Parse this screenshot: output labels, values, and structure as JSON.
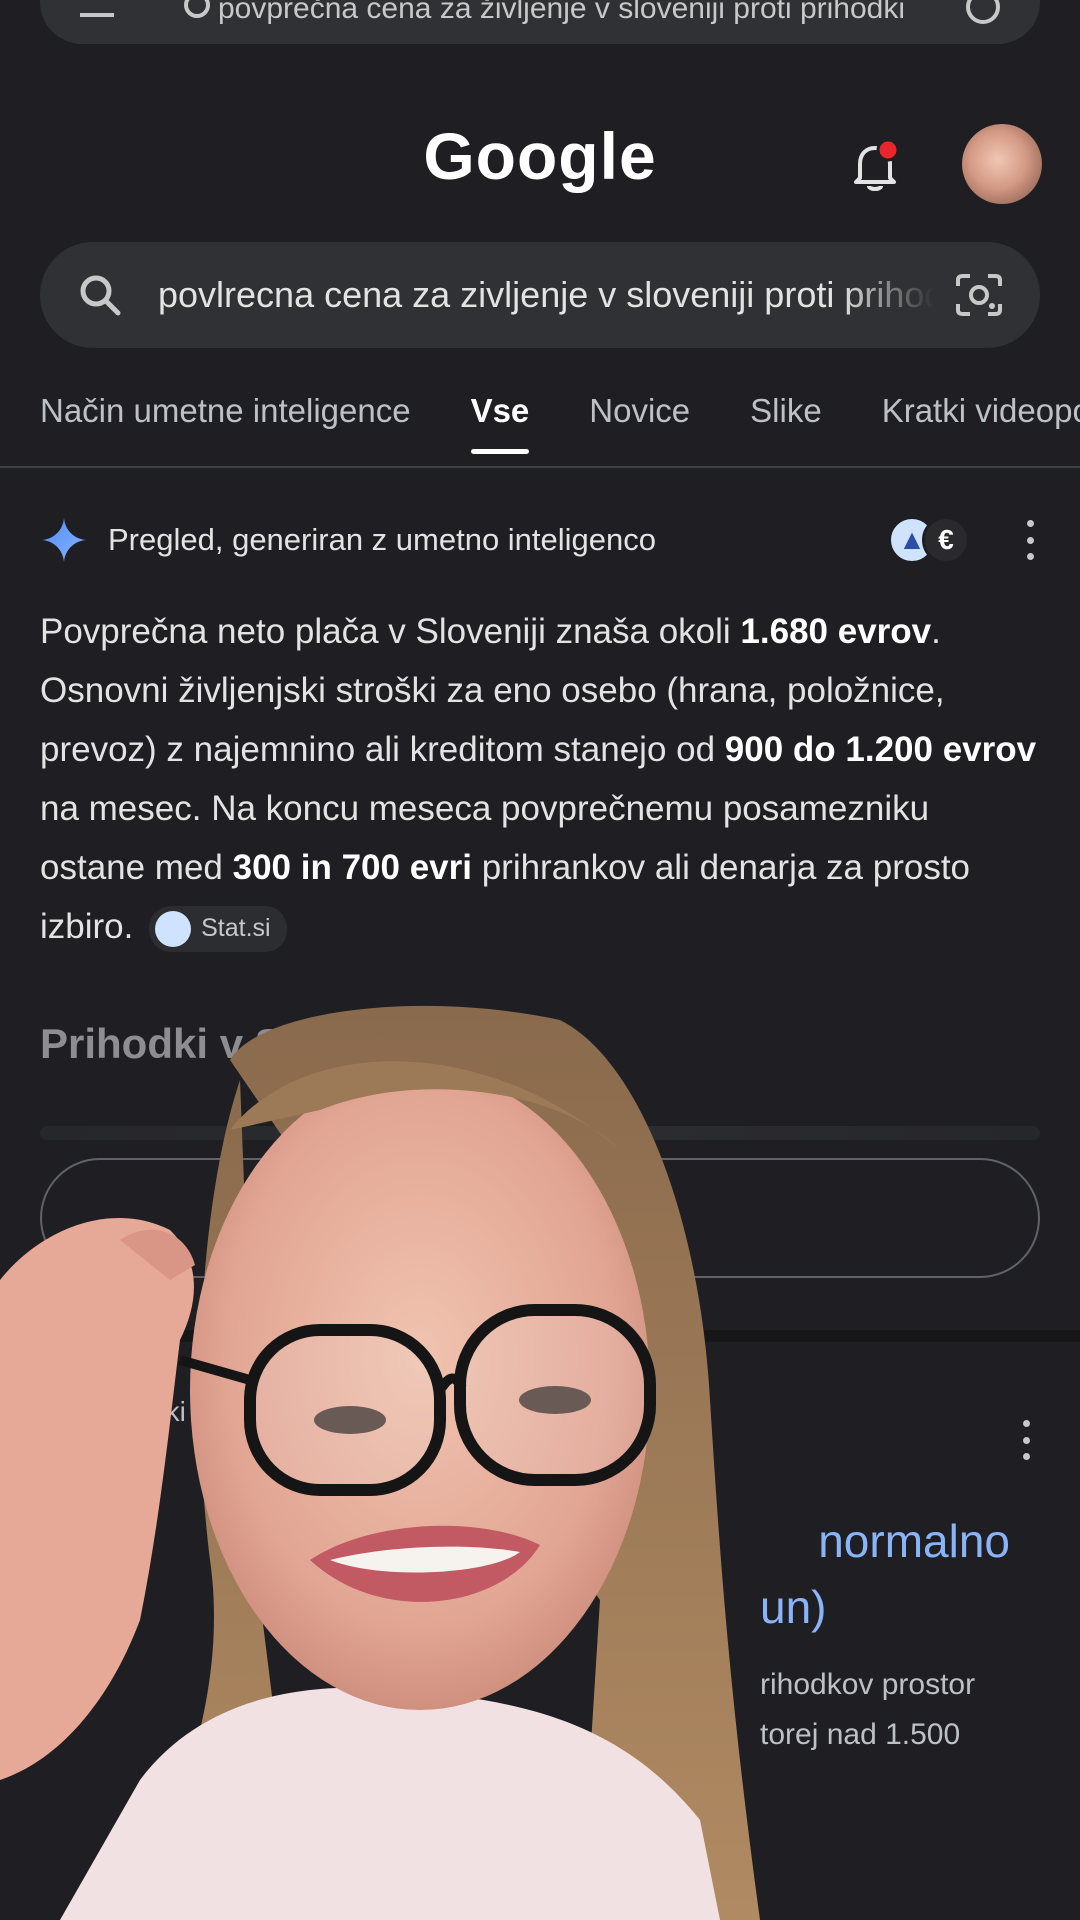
{
  "top_bar": {
    "query_text": "povprečna cena za življenje v sloveniji proti prihodki"
  },
  "header": {
    "logo": "Google"
  },
  "search": {
    "query": "povlrecna cena za zivljenje v sloveniji proti prihodki"
  },
  "tabs": [
    {
      "label": "Način umetne inteligence",
      "active": false
    },
    {
      "label": "Vse",
      "active": true
    },
    {
      "label": "Novice",
      "active": false
    },
    {
      "label": "Slike",
      "active": false
    },
    {
      "label": "Kratki videoposnetki",
      "active": false
    }
  ],
  "ai_overview": {
    "title": "Pregled, generiran z umetno inteligenco",
    "source_badge_2": "€",
    "p1": "Povprečna neto plača v Sloveniji znaša okoli ",
    "b1": "1.680 evrov",
    "p2": ". Osnovni življenjski stroški za eno osebo (hrana, položnice, prevoz) z najemnino ali kreditom stanejo od ",
    "b2": "900 do 1.200 evrov",
    "p3": " na mesec. Na koncu meseca povprečnemu posamezniku ostane med ",
    "b3": "300 in 700 evri",
    "p4": " prihrankov ali denarja za prosto izbiro.",
    "citation": "Stat.si"
  },
  "section": {
    "title": "Prihodki v Sl"
  },
  "result": {
    "meta": "eki",
    "title_visible": "normalno",
    "title_line2": "un)",
    "snippet_l1": "rihodkov prostor",
    "snippet_l2": "torej nad 1.500"
  },
  "colors": {
    "background": "#1f1f23",
    "link": "#8ab4f8",
    "notification_dot": "#e8262b"
  }
}
